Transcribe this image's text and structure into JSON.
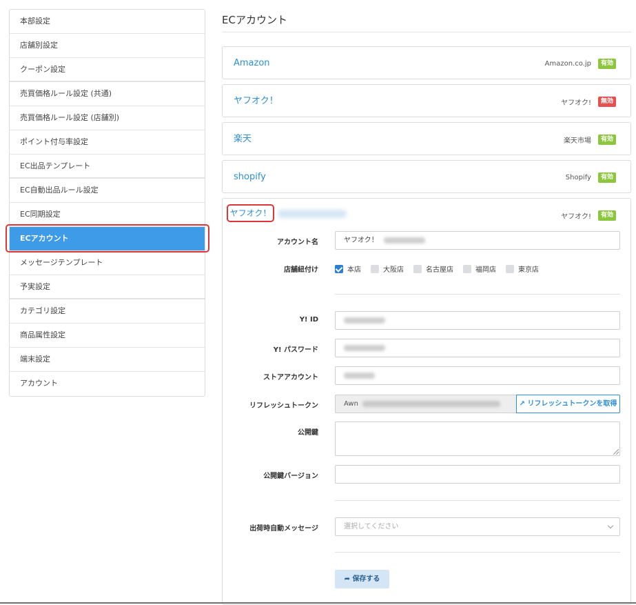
{
  "sidebar": {
    "items": [
      {
        "label": "本部設定"
      },
      {
        "label": "店舗別設定"
      },
      {
        "label": "クーポン設定"
      },
      {
        "label": "売買価格ルール設定 (共通)"
      },
      {
        "label": "売買価格ルール設定 (店舗別)"
      },
      {
        "label": "ポイント付与率設定"
      },
      {
        "label": "EC出品テンプレート"
      },
      {
        "label": "EC自動出品ルール設定"
      },
      {
        "label": "EC同期設定"
      },
      {
        "label": "ECアカウント"
      },
      {
        "label": "メッセージテンプレート"
      },
      {
        "label": "予実設定"
      },
      {
        "label": "カテゴリ設定"
      },
      {
        "label": "商品属性設定"
      },
      {
        "label": "端末設定"
      },
      {
        "label": "アカウント"
      }
    ],
    "active_index": 9
  },
  "page": {
    "title": "ECアカウント"
  },
  "accounts": [
    {
      "name": "Amazon",
      "store": "Amazon.co.jp",
      "status": "有効",
      "status_color": "#8cc63f"
    },
    {
      "name": "ヤフオク！",
      "store": "ヤフオク!",
      "status": "無効",
      "status_color": "#e55151"
    },
    {
      "name": "楽天",
      "store": "楽天市場",
      "status": "有効",
      "status_color": "#8cc63f"
    },
    {
      "name": "shopify",
      "store": "Shopify",
      "status": "有効",
      "status_color": "#8cc63f"
    }
  ],
  "expanded": {
    "name": "ヤフオク！",
    "store": "ヤフオク!",
    "status": "有効",
    "form": {
      "account_name_label": "アカウント名",
      "account_name_value": "ヤフオク！",
      "store_link_label": "店舗紐付け",
      "stores": [
        {
          "label": "本店",
          "checked": true
        },
        {
          "label": "大阪店",
          "checked": false
        },
        {
          "label": "名古屋店",
          "checked": false
        },
        {
          "label": "福岡店",
          "checked": false
        },
        {
          "label": "東京店",
          "checked": false
        }
      ],
      "yid_label": "Y! ID",
      "ypass_label": "Y! パスワード",
      "store_account_label": "ストアアカウント",
      "refresh_token_label": "リフレッシュトークン",
      "refresh_token_value": "Awn",
      "refresh_button": "リフレッシュトークンを取得",
      "public_key_label": "公開鍵",
      "public_key_version_label": "公開鍵バージョン",
      "auto_message_label": "出荷時自動メッセージ",
      "auto_message_placeholder": "選択してください",
      "save_button": "保存する"
    }
  }
}
